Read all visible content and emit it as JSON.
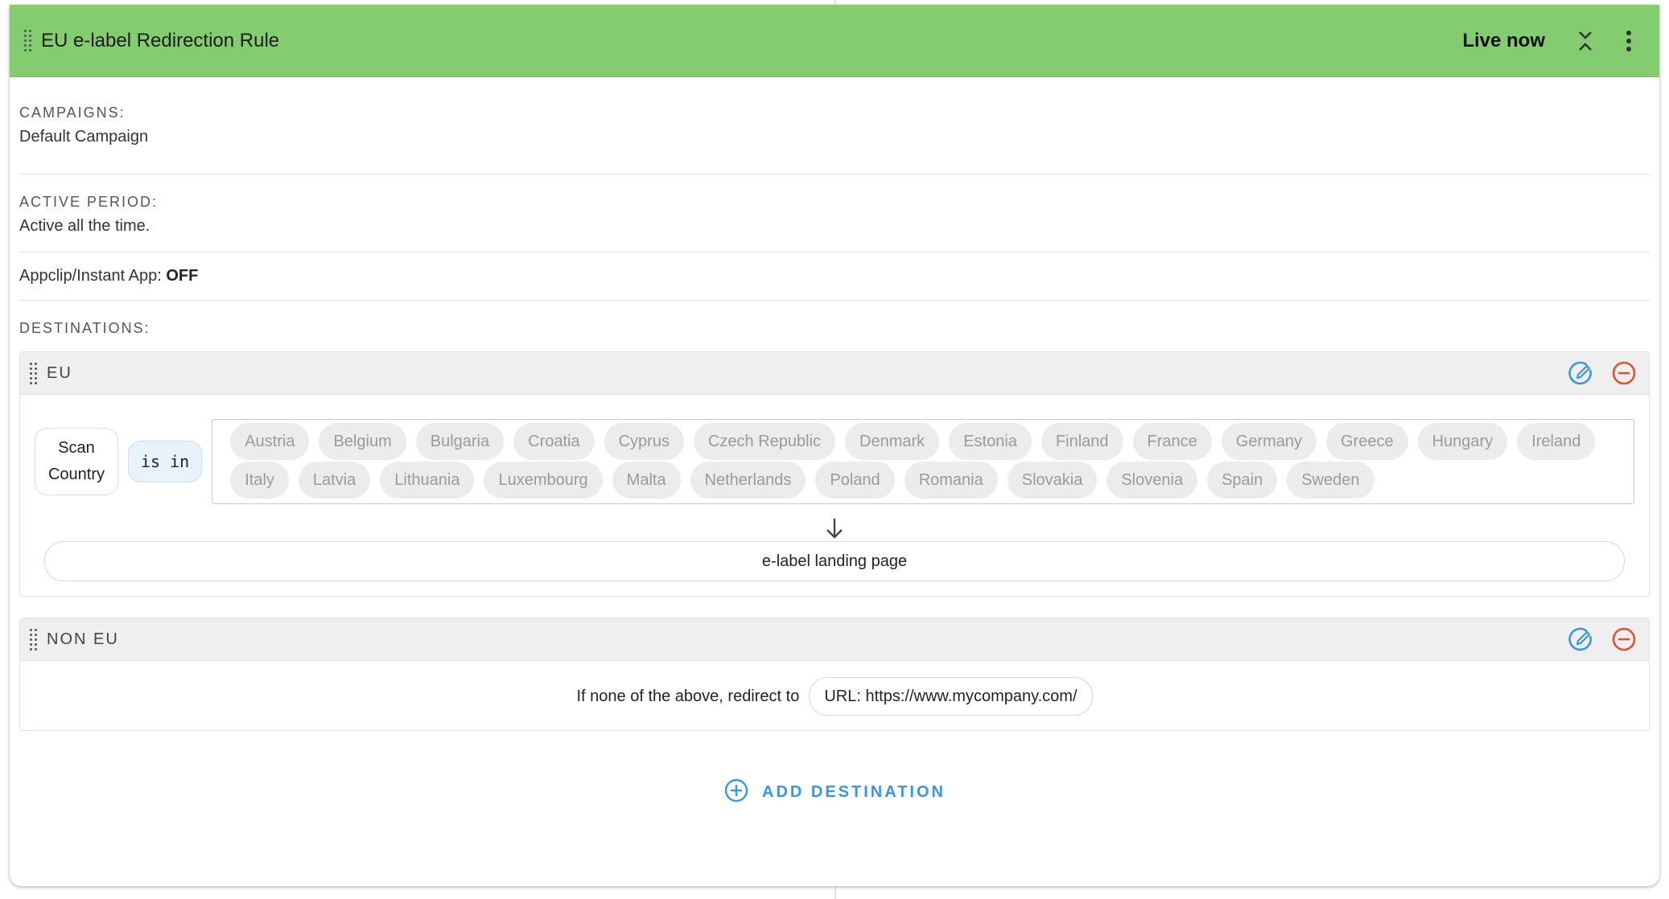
{
  "rule": {
    "title": "EU e-label Redirection Rule",
    "status": "Live now"
  },
  "campaigns": {
    "label": "CAMPAIGNS:",
    "value": "Default Campaign"
  },
  "active_period": {
    "label": "ACTIVE PERIOD:",
    "value": "Active all the time."
  },
  "appclip": {
    "label": "Appclip/Instant App:",
    "value": "OFF"
  },
  "destinations_label": "DESTINATIONS:",
  "destinations": [
    {
      "name": "EU",
      "condition": {
        "field": "Scan Country",
        "operator": "is in",
        "countries": [
          "Austria",
          "Belgium",
          "Bulgaria",
          "Croatia",
          "Cyprus",
          "Czech Republic",
          "Denmark",
          "Estonia",
          "Finland",
          "France",
          "Germany",
          "Greece",
          "Hungary",
          "Ireland",
          "Italy",
          "Latvia",
          "Lithuania",
          "Luxembourg",
          "Malta",
          "Netherlands",
          "Poland",
          "Romania",
          "Slovakia",
          "Slovenia",
          "Spain",
          "Sweden"
        ]
      },
      "target": "e-label landing page"
    },
    {
      "name": "NON EU",
      "fallback_text": "If none of the above, redirect to",
      "target": "URL: https://www.mycompany.com/"
    }
  ],
  "add_destination_label": "ADD DESTINATION",
  "colors": {
    "header_bg": "#84cc70",
    "accent_blue": "#3a96e0",
    "remove_red": "#e0503a"
  },
  "icons": {
    "drag": "drag-handle-icon",
    "collapse": "collapse-icon",
    "more": "more-vertical-icon",
    "edit": "edit-icon",
    "remove": "remove-circle-icon",
    "arrow": "arrow-down-icon",
    "add": "add-circle-icon"
  }
}
